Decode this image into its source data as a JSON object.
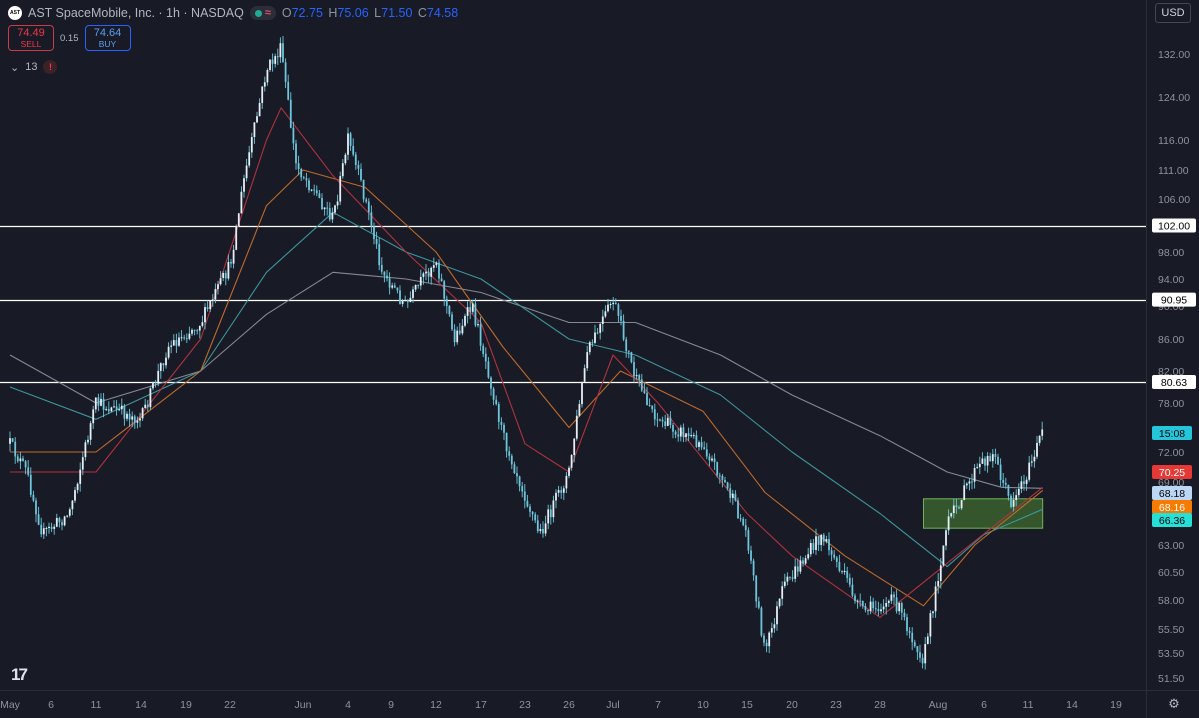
{
  "header": {
    "symbol_title": "AST SpaceMobile, Inc. · 1h · NASDAQ",
    "ohlc": [
      {
        "key": "O",
        "value": "72.75"
      },
      {
        "key": "H",
        "value": "75.06"
      },
      {
        "key": "L",
        "value": "71.50"
      },
      {
        "key": "C",
        "value": "74.58"
      }
    ],
    "logo_text": "AST"
  },
  "trade": {
    "sell_price": "74.49",
    "sell_label": "SELL",
    "spread": "0.15",
    "buy_price": "74.64",
    "buy_label": "BUY"
  },
  "indicators": {
    "count": "13",
    "chevron": "⌄",
    "alert": "!"
  },
  "currency": "USD",
  "icons": [
    "logo-badge",
    "green-status-dot",
    "wave-icon",
    "chevron-down-icon",
    "alert-icon",
    "tradingview-logo",
    "settings-icon"
  ],
  "colors": {
    "background": "#181b25",
    "candle": "#6dc6dc",
    "ema_red": "#b7343d",
    "ema_orange": "#c96e2a",
    "ema_teal": "#3f9aa3",
    "sma_gray": "#8a8f9a",
    "level_line": "#ffffff",
    "zone_fill": "#3f6b2f",
    "zone_border": "#6fb45b"
  },
  "chart_data": {
    "type": "candlestick",
    "price_axis_ticks": [
      "132.00",
      "124.00",
      "116.00",
      "111.00",
      "106.00",
      "98.00",
      "94.00",
      "90.00",
      "86.00",
      "82.00",
      "78.00",
      "72.00",
      "69.00",
      "63.00",
      "60.50",
      "58.00",
      "55.50",
      "53.50",
      "51.50"
    ],
    "time_axis_ticks": [
      "May",
      "6",
      "11",
      "14",
      "19",
      "22",
      "Jun",
      "4",
      "9",
      "12",
      "17",
      "23",
      "26",
      "Jul",
      "7",
      "10",
      "15",
      "20",
      "23",
      "28",
      "Aug",
      "6",
      "11",
      "14",
      "19"
    ],
    "horizontal_levels": [
      {
        "label": "102.00",
        "value": 102.0
      },
      {
        "label": "90.95",
        "value": 90.95
      },
      {
        "label": "80.63",
        "value": 80.63
      }
    ],
    "price_labels": [
      {
        "text": "15:08",
        "bg": "#26c6da",
        "fg": "#000000",
        "value": 74.6
      },
      {
        "text": "70.25",
        "bg": "#e53935",
        "fg": "#ffffff",
        "value": 70.25
      },
      {
        "text": "68.18",
        "bg": "#bcd6f5",
        "fg": "#000000",
        "value": 68.18
      },
      {
        "text": "68.16",
        "bg": "#f57c00",
        "fg": "#ffffff",
        "value": 68.16
      },
      {
        "text": "66.36",
        "bg": "#26e0d8",
        "fg": "#000000",
        "value": 66.36
      }
    ],
    "demand_zone": {
      "from_time": "Jul 31",
      "to_time": "Aug 12",
      "low": 64.6,
      "high": 67.4
    },
    "price_path": [
      {
        "t": "May 1",
        "p": 73
      },
      {
        "t": "May 3",
        "p": 70
      },
      {
        "t": "May 5",
        "p": 64
      },
      {
        "t": "May 8",
        "p": 66
      },
      {
        "t": "May 11",
        "p": 78
      },
      {
        "t": "May 14",
        "p": 76
      },
      {
        "t": "May 17",
        "p": 85
      },
      {
        "t": "May 20",
        "p": 88
      },
      {
        "t": "May 22",
        "p": 96
      },
      {
        "t": "May 24",
        "p": 110
      },
      {
        "t": "May 27",
        "p": 129
      },
      {
        "t": "May 29",
        "p": 133
      },
      {
        "t": "May 31",
        "p": 112
      },
      {
        "t": "Jun 3",
        "p": 103
      },
      {
        "t": "Jun 4",
        "p": 116
      },
      {
        "t": "Jun 6",
        "p": 106
      },
      {
        "t": "Jun 8",
        "p": 95
      },
      {
        "t": "Jun 10",
        "p": 90
      },
      {
        "t": "Jun 12",
        "p": 97
      },
      {
        "t": "Jun 14",
        "p": 86
      },
      {
        "t": "Jun 16",
        "p": 90
      },
      {
        "t": "Jun 18",
        "p": 82
      },
      {
        "t": "Jun 20",
        "p": 74
      },
      {
        "t": "Jun 24",
        "p": 64
      },
      {
        "t": "Jun 26",
        "p": 70
      },
      {
        "t": "Jun 28",
        "p": 84
      },
      {
        "t": "Jul 1",
        "p": 91
      },
      {
        "t": "Jul 4",
        "p": 81
      },
      {
        "t": "Jul 7",
        "p": 76
      },
      {
        "t": "Jul 10",
        "p": 73
      },
      {
        "t": "Jul 13",
        "p": 68
      },
      {
        "t": "Jul 15",
        "p": 64
      },
      {
        "t": "Jul 17",
        "p": 53.5
      },
      {
        "t": "Jul 19",
        "p": 59
      },
      {
        "t": "Jul 22",
        "p": 64
      },
      {
        "t": "Jul 24",
        "p": 60
      },
      {
        "t": "Jul 26",
        "p": 57
      },
      {
        "t": "Jul 29",
        "p": 58
      },
      {
        "t": "Jul 31",
        "p": 53
      },
      {
        "t": "Aug 2",
        "p": 65
      },
      {
        "t": "Aug 5",
        "p": 70
      },
      {
        "t": "Aug 7",
        "p": 72
      },
      {
        "t": "Aug 9",
        "p": 67
      },
      {
        "t": "Aug 11",
        "p": 70
      },
      {
        "t": "Aug 12",
        "p": 74.6
      }
    ],
    "ema_red_path": [
      {
        "t": "May 1",
        "p": 70
      },
      {
        "t": "May 11",
        "p": 70
      },
      {
        "t": "May 20",
        "p": 86
      },
      {
        "t": "May 27",
        "p": 116
      },
      {
        "t": "May 29",
        "p": 122
      },
      {
        "t": "Jun 3",
        "p": 110
      },
      {
        "t": "Jun 10",
        "p": 98
      },
      {
        "t": "Jun 17",
        "p": 88
      },
      {
        "t": "Jun 23",
        "p": 73
      },
      {
        "t": "Jun 26",
        "p": 70
      },
      {
        "t": "Jul 1",
        "p": 84
      },
      {
        "t": "Jul 7",
        "p": 78
      },
      {
        "t": "Jul 15",
        "p": 66
      },
      {
        "t": "Jul 20",
        "p": 62
      },
      {
        "t": "Jul 28",
        "p": 56.5
      },
      {
        "t": "Aug 3",
        "p": 62
      },
      {
        "t": "Aug 12",
        "p": 68.5
      }
    ],
    "ema_orange_path": [
      {
        "t": "May 1",
        "p": 72
      },
      {
        "t": "May 11",
        "p": 72
      },
      {
        "t": "May 20",
        "p": 82
      },
      {
        "t": "May 27",
        "p": 105
      },
      {
        "t": "Jun 1",
        "p": 111
      },
      {
        "t": "Jun 6",
        "p": 108
      },
      {
        "t": "Jun 12",
        "p": 98
      },
      {
        "t": "Jun 20",
        "p": 85
      },
      {
        "t": "Jun 26",
        "p": 75
      },
      {
        "t": "Jul 2",
        "p": 82
      },
      {
        "t": "Jul 10",
        "p": 77
      },
      {
        "t": "Jul 17",
        "p": 68
      },
      {
        "t": "Jul 24",
        "p": 62
      },
      {
        "t": "Jul 31",
        "p": 57.5
      },
      {
        "t": "Aug 5",
        "p": 63
      },
      {
        "t": "Aug 12",
        "p": 68.2
      }
    ],
    "ema_teal_path": [
      {
        "t": "May 1",
        "p": 80
      },
      {
        "t": "May 11",
        "p": 76
      },
      {
        "t": "May 20",
        "p": 82
      },
      {
        "t": "May 27",
        "p": 95
      },
      {
        "t": "Jun 3",
        "p": 104
      },
      {
        "t": "Jun 10",
        "p": 98
      },
      {
        "t": "Jun 17",
        "p": 94
      },
      {
        "t": "Jun 26",
        "p": 86
      },
      {
        "t": "Jul 4",
        "p": 84
      },
      {
        "t": "Jul 12",
        "p": 79
      },
      {
        "t": "Jul 20",
        "p": 72
      },
      {
        "t": "Jul 28",
        "p": 66
      },
      {
        "t": "Aug 2",
        "p": 61
      },
      {
        "t": "Aug 6",
        "p": 64
      },
      {
        "t": "Aug 12",
        "p": 66.4
      }
    ],
    "sma_gray_path": [
      {
        "t": "May 1",
        "p": 84
      },
      {
        "t": "May 11",
        "p": 78
      },
      {
        "t": "May 20",
        "p": 82
      },
      {
        "t": "May 27",
        "p": 89
      },
      {
        "t": "Jun 3",
        "p": 95
      },
      {
        "t": "Jun 10",
        "p": 94
      },
      {
        "t": "Jun 17",
        "p": 92
      },
      {
        "t": "Jun 26",
        "p": 88
      },
      {
        "t": "Jul 4",
        "p": 88
      },
      {
        "t": "Jul 12",
        "p": 84
      },
      {
        "t": "Jul 20",
        "p": 79
      },
      {
        "t": "Jul 28",
        "p": 74
      },
      {
        "t": "Aug 2",
        "p": 70
      },
      {
        "t": "Aug 8",
        "p": 68.5
      },
      {
        "t": "Aug 12",
        "p": 68.4
      }
    ]
  }
}
